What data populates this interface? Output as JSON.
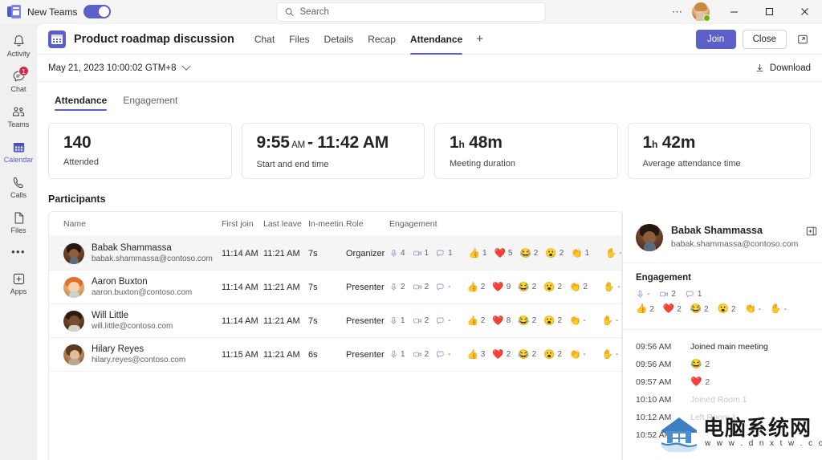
{
  "titlebar": {
    "app_toggle_label": "New Teams",
    "toggle_state": "on",
    "search_placeholder": "Search",
    "more_icon": "ellipsis-icon",
    "minimize": "minimize-icon",
    "maximize": "maximize-icon",
    "close": "close-icon"
  },
  "rail": {
    "items": [
      {
        "label": "Activity",
        "icon": "bell-icon",
        "badge": null,
        "active": false
      },
      {
        "label": "Chat",
        "icon": "chat-icon",
        "badge": "1",
        "active": false
      },
      {
        "label": "Teams",
        "icon": "teams-icon",
        "badge": null,
        "active": false
      },
      {
        "label": "Calendar",
        "icon": "calendar-icon",
        "badge": null,
        "active": true
      },
      {
        "label": "Calls",
        "icon": "phone-icon",
        "badge": null,
        "active": false
      },
      {
        "label": "Files",
        "icon": "file-icon",
        "badge": null,
        "active": false
      },
      {
        "label": "Apps",
        "icon": "apps-plus-icon",
        "badge": null,
        "active": false
      }
    ],
    "more_label": "•••"
  },
  "header": {
    "meeting_title": "Product roadmap discussion",
    "meeting_icon": "meeting-calendar-icon",
    "tabs": [
      {
        "label": "Chat",
        "active": false
      },
      {
        "label": "Files",
        "active": false
      },
      {
        "label": "Details",
        "active": false
      },
      {
        "label": "Recap",
        "active": false
      },
      {
        "label": "Attendance",
        "active": true
      }
    ],
    "add_tab": "+",
    "join_label": "Join",
    "close_label": "Close",
    "popout_icon": "pop-out-icon",
    "accent_color": "#5b5fc7"
  },
  "session": {
    "date_label": "May 21, 2023 10:00:02 GTM+8",
    "dropdown_icon": "chevron-down-icon",
    "download_label": "Download",
    "download_icon": "download-icon"
  },
  "subtabs": [
    {
      "label": "Attendance",
      "active": true
    },
    {
      "label": "Engagement",
      "active": false
    }
  ],
  "stats": [
    {
      "value": "140",
      "unit": "",
      "suffix": "",
      "label": "Attended"
    },
    {
      "value": "9:55",
      "unit": " AM ",
      "suffix": "- 11:42 AM",
      "label": "Start and end time"
    },
    {
      "value": "1",
      "unit": "h",
      "suffix": " 48m",
      "label": "Meeting duration"
    },
    {
      "value": "1",
      "unit": "h",
      "suffix": " 42m",
      "label": "Average attendance time"
    }
  ],
  "participants": {
    "section_title": "Participants",
    "columns": [
      "Name",
      "First join",
      "Last leave",
      "In-meetin...",
      "Role",
      "Engagement"
    ],
    "rows": [
      {
        "name": "Babak Shammassa",
        "email": "babak.shammassa@contoso.com",
        "first_join": "11:14 AM",
        "last_leave": "11:21 AM",
        "in_meeting": "7s",
        "role": "Organizer",
        "selected": true,
        "activity": [
          {
            "icon": "mic-icon",
            "count": "4"
          },
          {
            "icon": "camera-icon",
            "count": "1"
          },
          {
            "icon": "chat-bubble-icon",
            "count": "1"
          }
        ],
        "reactions": [
          {
            "emoji": "👍",
            "name": "thumbs-up",
            "count": "1"
          },
          {
            "emoji": "❤️",
            "name": "heart",
            "count": "5"
          },
          {
            "emoji": "😂",
            "name": "laugh",
            "count": "2"
          },
          {
            "emoji": "😮",
            "name": "surprised",
            "count": "2"
          },
          {
            "emoji": "👏",
            "name": "applause",
            "count": "1"
          }
        ],
        "raise_hand": {
          "emoji": "✋",
          "name": "raise-hand",
          "count": "-"
        }
      },
      {
        "name": "Aaron Buxton",
        "email": "aaron.buxton@contoso.com",
        "first_join": "11:14 AM",
        "last_leave": "11:21 AM",
        "in_meeting": "7s",
        "role": "Presenter",
        "selected": false,
        "activity": [
          {
            "icon": "mic-icon",
            "count": "2"
          },
          {
            "icon": "camera-icon",
            "count": "2"
          },
          {
            "icon": "chat-bubble-icon",
            "count": "-"
          }
        ],
        "reactions": [
          {
            "emoji": "👍",
            "name": "thumbs-up",
            "count": "2"
          },
          {
            "emoji": "❤️",
            "name": "heart",
            "count": "9"
          },
          {
            "emoji": "😂",
            "name": "laugh",
            "count": "2"
          },
          {
            "emoji": "😮",
            "name": "surprised",
            "count": "2"
          },
          {
            "emoji": "👏",
            "name": "applause",
            "count": "2"
          }
        ],
        "raise_hand": {
          "emoji": "✋",
          "name": "raise-hand",
          "count": "-"
        }
      },
      {
        "name": "Will Little",
        "email": "will.little@contoso.com",
        "first_join": "11:14 AM",
        "last_leave": "11:21 AM",
        "in_meeting": "7s",
        "role": "Presenter",
        "selected": false,
        "activity": [
          {
            "icon": "mic-icon",
            "count": "1"
          },
          {
            "icon": "camera-icon",
            "count": "2"
          },
          {
            "icon": "chat-bubble-icon",
            "count": "-"
          }
        ],
        "reactions": [
          {
            "emoji": "👍",
            "name": "thumbs-up",
            "count": "2"
          },
          {
            "emoji": "❤️",
            "name": "heart",
            "count": "8"
          },
          {
            "emoji": "😂",
            "name": "laugh",
            "count": "2"
          },
          {
            "emoji": "😮",
            "name": "surprised",
            "count": "2"
          },
          {
            "emoji": "👏",
            "name": "applause",
            "count": "-"
          }
        ],
        "raise_hand": {
          "emoji": "✋",
          "name": "raise-hand",
          "count": "-"
        }
      },
      {
        "name": "Hilary Reyes",
        "email": "hilary.reyes@contoso.com",
        "first_join": "11:15 AM",
        "last_leave": "11:21 AM",
        "in_meeting": "6s",
        "role": "Presenter",
        "selected": false,
        "activity": [
          {
            "icon": "mic-icon",
            "count": "1"
          },
          {
            "icon": "camera-icon",
            "count": "2"
          },
          {
            "icon": "chat-bubble-icon",
            "count": "-"
          }
        ],
        "reactions": [
          {
            "emoji": "👍",
            "name": "thumbs-up",
            "count": "3"
          },
          {
            "emoji": "❤️",
            "name": "heart",
            "count": "2"
          },
          {
            "emoji": "😂",
            "name": "laugh",
            "count": "2"
          },
          {
            "emoji": "😮",
            "name": "surprised",
            "count": "2"
          },
          {
            "emoji": "👏",
            "name": "applause",
            "count": "-"
          }
        ],
        "raise_hand": {
          "emoji": "✋",
          "name": "raise-hand",
          "count": "-"
        }
      }
    ]
  },
  "detail_panel": {
    "name": "Babak Shammassa",
    "email": "babak.shammassa@contoso.com",
    "expand_icon": "expand-panel-icon",
    "engagement_title": "Engagement",
    "activity": [
      {
        "icon": "mic-icon",
        "count": "-"
      },
      {
        "icon": "camera-icon",
        "count": "2"
      },
      {
        "icon": "chat-bubble-icon",
        "count": "1"
      }
    ],
    "reactions": [
      {
        "emoji": "👍",
        "name": "thumbs-up",
        "count": "2"
      },
      {
        "emoji": "❤️",
        "name": "heart",
        "count": "2"
      },
      {
        "emoji": "😂",
        "name": "laugh",
        "count": "2"
      },
      {
        "emoji": "😮",
        "name": "surprised",
        "count": "2"
      },
      {
        "emoji": "👏",
        "name": "applause",
        "count": "-"
      },
      {
        "emoji": "✋",
        "name": "raise-hand",
        "count": "-"
      }
    ],
    "timeline": [
      {
        "time": "09:56 AM",
        "text": "Joined main meeting",
        "emoji": "",
        "count": "",
        "faded": false
      },
      {
        "time": "09:56 AM",
        "text": "",
        "emoji": "😂",
        "count": "2",
        "faded": false
      },
      {
        "time": "09:57 AM",
        "text": "",
        "emoji": "❤️",
        "count": "2",
        "faded": false
      },
      {
        "time": "10:10 AM",
        "text": "Joined Room 1",
        "emoji": "",
        "count": "",
        "faded": true
      },
      {
        "time": "10:12 AM",
        "text": "Left Room 1",
        "emoji": "",
        "count": "",
        "faded": true
      },
      {
        "time": "10:52 AM",
        "text": "",
        "emoji": "",
        "count": "",
        "faded": true
      }
    ]
  },
  "watermark": {
    "text": "电脑系统网",
    "url": "w w w . d n x t w . c o m"
  }
}
